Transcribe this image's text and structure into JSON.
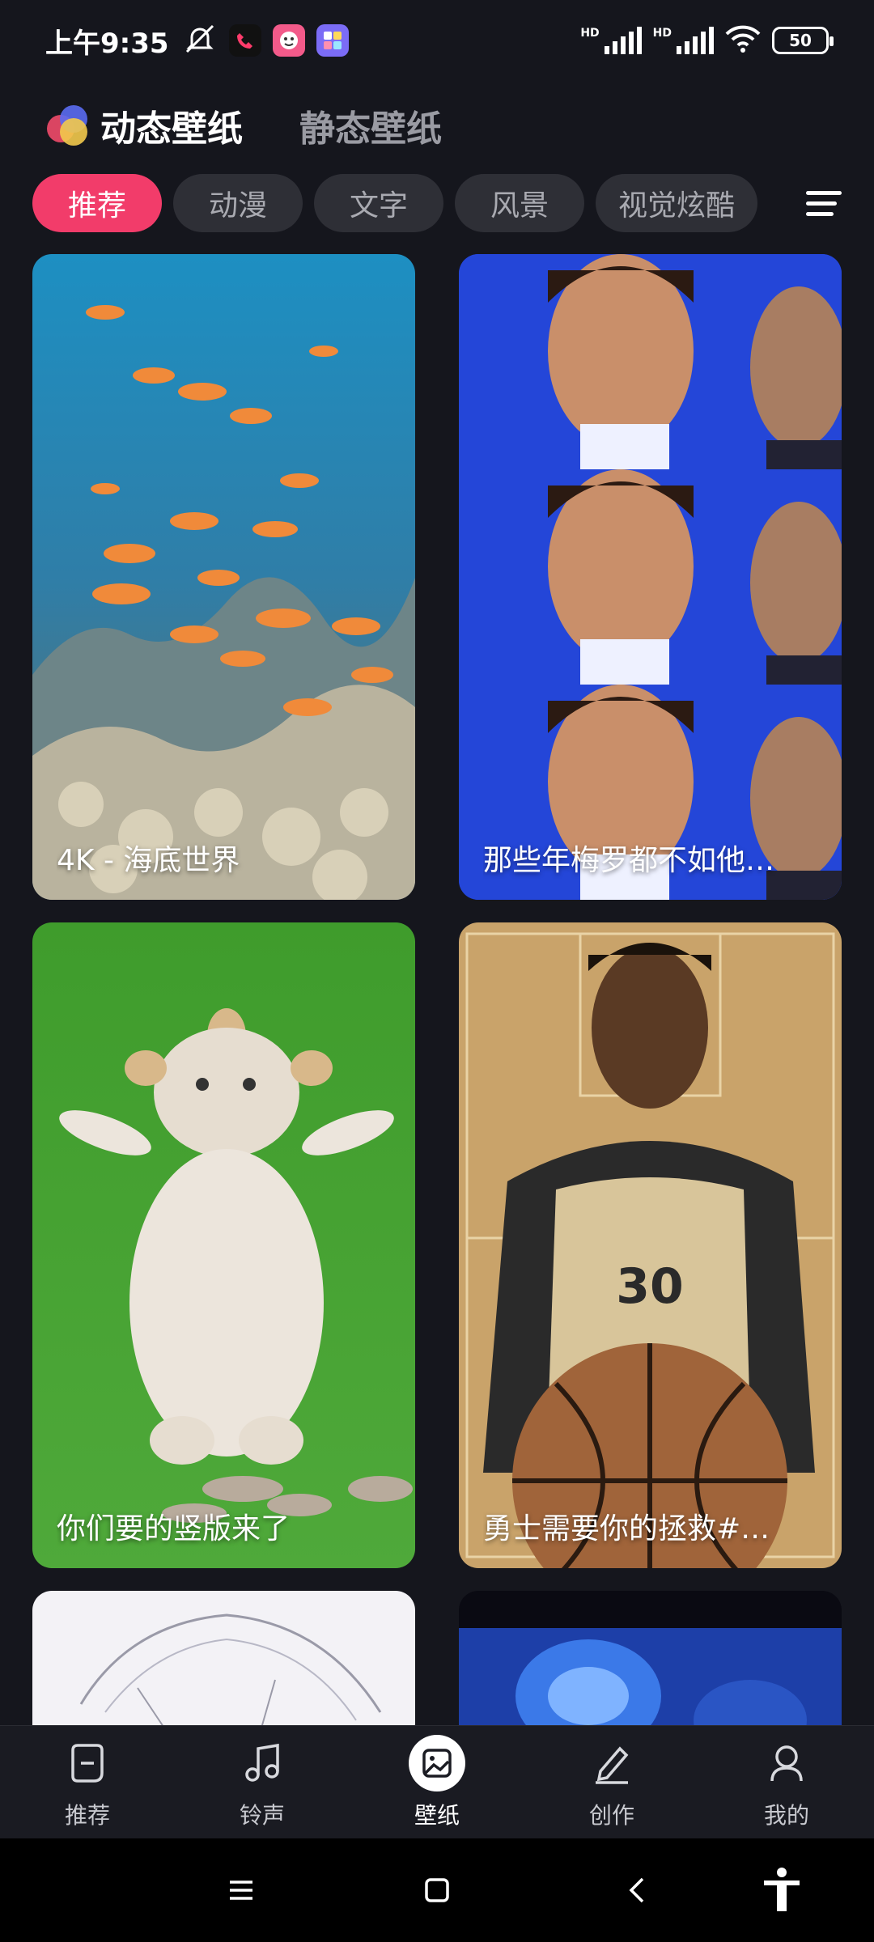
{
  "status": {
    "time": "上午9:35",
    "hd1": "HD",
    "hd2": "HD",
    "battery": "50"
  },
  "header": {
    "tabs": [
      {
        "label": "动态壁纸",
        "active": true
      },
      {
        "label": "静态壁纸",
        "active": false
      }
    ]
  },
  "categories": {
    "items": [
      "推荐",
      "动漫",
      "文字",
      "风景",
      "视觉炫酷"
    ],
    "active_index": 0
  },
  "cards": [
    {
      "title": "4K - 海底世界",
      "theme": "ocean-coral"
    },
    {
      "title": "那些年梅罗都不如他…",
      "theme": "three-faces-blue"
    },
    {
      "title": "你们要的竖版来了",
      "theme": "white-creature-grass"
    },
    {
      "title": "勇士需要你的拯救#…",
      "theme": "basketball-player-sepia"
    },
    {
      "title": "",
      "theme": "white-hair-anime"
    },
    {
      "title": "",
      "theme": "blue-lion-art"
    }
  ],
  "bottom_nav": {
    "items": [
      {
        "label": "推荐",
        "icon": "recommend-icon"
      },
      {
        "label": "铃声",
        "icon": "music-note-icon"
      },
      {
        "label": "壁纸",
        "icon": "wallpaper-icon"
      },
      {
        "label": "创作",
        "icon": "pencil-icon"
      },
      {
        "label": "我的",
        "icon": "profile-icon"
      }
    ],
    "active_index": 2
  },
  "system_nav": {
    "icons": [
      "menu-icon",
      "home-icon",
      "back-icon",
      "accessibility-icon"
    ]
  },
  "colors": {
    "accent": "#f23c6a",
    "background": "#15161d",
    "chip": "#2e2f36"
  }
}
